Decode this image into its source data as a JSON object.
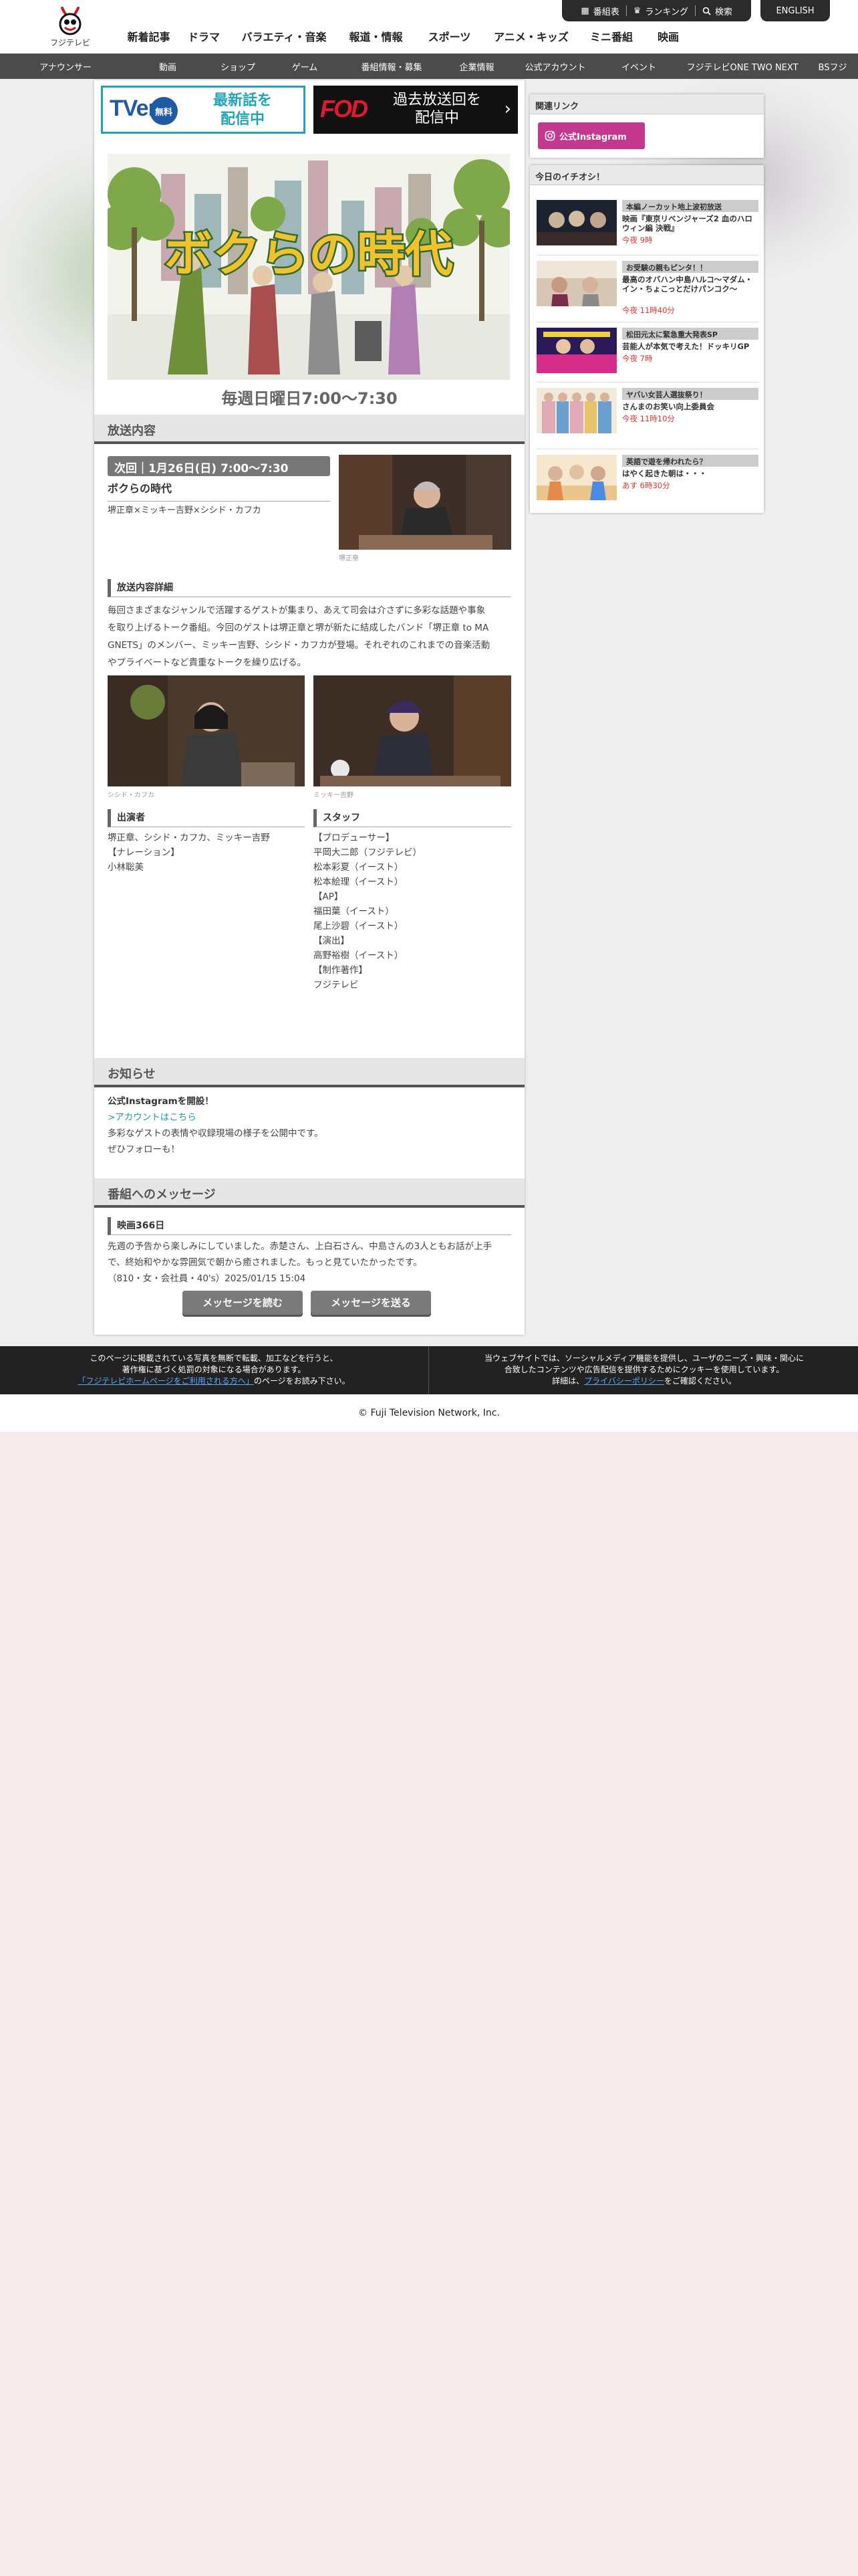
{
  "header": {
    "logo_text": "フジテレビ",
    "topbar": {
      "program_table": "番組表",
      "ranking": "ランキング",
      "search": "検索",
      "english": "ENGLISH"
    },
    "main_nav": [
      "新着記事",
      "ドラマ",
      "バラエティ・音楽",
      "報道・情報",
      "スポーツ",
      "アニメ・キッズ",
      "ミニ番組",
      "映画"
    ],
    "sub_nav": [
      "アナウンサー",
      "動画",
      "ショップ",
      "ゲーム",
      "番組情報・募集",
      "企業情報",
      "公式アカウント",
      "イベント",
      "フジテレビONE TWO NEXT",
      "BSフジ"
    ]
  },
  "banners": {
    "tver_logo": "TVer",
    "tver_badge": "無料",
    "tver_line1": "最新話を",
    "tver_line2": "配信中",
    "fod_logo": "FOD",
    "fod_line1": "過去放送回を",
    "fod_line2": "配信中",
    "fod_arrow": "›"
  },
  "hero": {
    "logo_text": "ボクらの時代",
    "schedule": "毎週日曜日7:00〜7:30"
  },
  "broadcast": {
    "section_title": "放送内容",
    "next_label": "次回｜1月26日(日) 7:00〜7:30",
    "program_title": "ボクらの時代",
    "cast_line": "堺正章×ミッキー吉野×シシド・カフカ",
    "photo_caption_main": "堺正章",
    "detail_head": "放送内容詳細",
    "detail_lines": [
      "毎回さまざまなジャンルで活躍するゲストが集まり、あえて司会は介さずに多彩な話題や事象",
      "を取り上げるトーク番組。今回のゲストは堺正章と堺が新たに結成したバンド「堺正章 to MA",
      "GNETS」のメンバー、ミッキー吉野、シシド・カフカが登場。それぞれのこれまでの音楽活動",
      "やプライベートなど貴重なトークを繰り広げる。"
    ],
    "caption_left": "シシド・カフカ",
    "caption_right": "ミッキー吉野",
    "performers_head": "出演者",
    "performers_lines": [
      "堺正章、シシド・カフカ、ミッキー吉野",
      "",
      "【ナレーション】",
      "小林聡美"
    ],
    "staff_head": "スタッフ",
    "staff_lines": [
      "【プロデューサー】",
      "平岡大二郎（フジテレビ）",
      "松本彩夏（イースト）",
      "松本絵理（イースト）",
      "",
      "【AP】",
      "福田葉（イースト）",
      "尾上沙碧（イースト）",
      "",
      "【演出】",
      "高野裕樹（イースト）",
      "",
      "【制作著作】",
      "フジテレビ"
    ]
  },
  "notice": {
    "section_title": "お知らせ",
    "headline": "公式Instagramを開設！",
    "link": ">アカウントはこちら",
    "line1": "多彩なゲストの表情や収録現場の様子を公開中です。",
    "line2": "ぜひフォローも！"
  },
  "messages": {
    "section_title": "番組へのメッセージ",
    "title": "映画366日",
    "body_lines": [
      "先週の予告から楽しみにしていました。赤楚さん、上白石さん、中島さんの3人ともお話が上手",
      "で、終始和やかな雰囲気で朝から癒されました。もっと見ていたかったです。"
    ],
    "meta": "（810・女・会社員・40's）2025/01/15 15:04",
    "read_button": "メッセージを読む",
    "send_button": "メッセージを送る"
  },
  "sidebar": {
    "related_title": "関連リンク",
    "instagram_label": "公式Instagram",
    "picks_title": "今日のイチオシ！",
    "picks": [
      {
        "tag": "本編ノーカット地上波初放送",
        "title": "映画『東京リベンジャーズ2 血のハロウィン編 決戦』",
        "time": "今夜 9時"
      },
      {
        "tag": "お受験の親もピンタ！！",
        "title": "最高のオバハン中島ハルコ〜マダム・イン・ちょこっとだけパンコク〜",
        "time": "今夜 11時40分"
      },
      {
        "tag": "松田元太に緊急重大発表SP",
        "title": "芸能人が本気で考えた！ドッキリGP",
        "time": "今夜 7時"
      },
      {
        "tag": "ヤバい女芸人選抜祭り！",
        "title": "さんまのお笑い向上委員会",
        "time": "今夜 11時10分"
      },
      {
        "tag": "英語で遊を帰われたら？",
        "title": "はやく起きた朝は・・・",
        "time": "あす 6時30分"
      }
    ]
  },
  "footer": {
    "left_line1": "このページに掲載されている写真を無断で転載、加工などを行うと、",
    "left_line2": "著作権に基づく処罰の対象になる場合があります。",
    "left_link": "「フジテレビホームページをご利用される方へ」",
    "left_line3": "のページをお読み下さい。",
    "right_line1": "当ウェブサイトでは、ソーシャルメディア機能を提供し、ユーザのニーズ・興味・関心に",
    "right_line2": "合致したコンテンツや広告配信を提供するためにクッキーを使用しています。",
    "right_pre": "詳細は、",
    "right_link": "プライバシーポリシー",
    "right_post": "をご確認ください。",
    "copyright": "© Fuji Television Network, Inc."
  }
}
